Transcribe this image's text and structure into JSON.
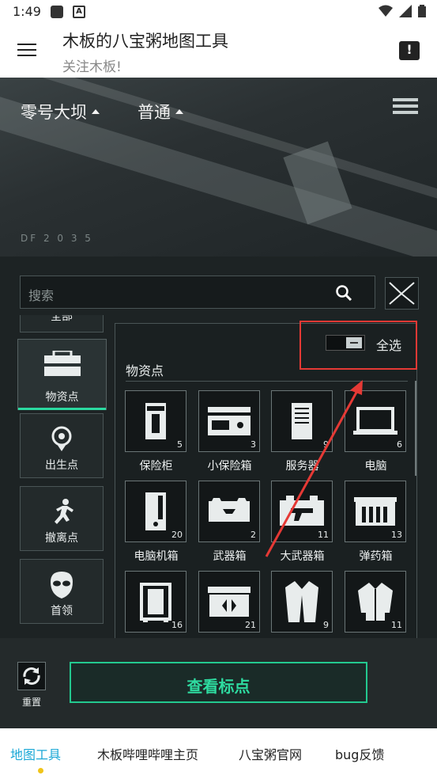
{
  "status_bar": {
    "time": "1:49",
    "icons": [
      "wifi-icon",
      "signal-icon",
      "battery-icon"
    ]
  },
  "app_bar": {
    "title": "木板的八宝粥地图工具",
    "subtitle": "关注木板!"
  },
  "map_header": {
    "map_name": "零号大坝",
    "difficulty": "普通",
    "df_text": "DF 2 0 3 5"
  },
  "search": {
    "placeholder": "搜索"
  },
  "categories": [
    {
      "label": "物资点",
      "active": true,
      "icon": "crate-icon"
    },
    {
      "label": "出生点",
      "active": false,
      "icon": "location-target-icon"
    },
    {
      "label": "撤离点",
      "active": false,
      "icon": "running-man-icon"
    },
    {
      "label": "首领",
      "active": false,
      "icon": "mask-icon"
    }
  ],
  "top_partial_category": "全部",
  "select_all": {
    "label": "全选"
  },
  "section_title": "物资点",
  "items": [
    {
      "label": "保险柜",
      "count": "5",
      "icon": "safe-icon"
    },
    {
      "label": "小保险箱",
      "count": "3",
      "icon": "small-safe-icon"
    },
    {
      "label": "服务器",
      "count": "9",
      "icon": "server-icon"
    },
    {
      "label": "电脑",
      "count": "6",
      "icon": "laptop-icon"
    },
    {
      "label": "电脑机箱",
      "count": "20",
      "icon": "pc-case-icon"
    },
    {
      "label": "武器箱",
      "count": "2",
      "icon": "weapon-case-icon"
    },
    {
      "label": "大武器箱",
      "count": "11",
      "icon": "large-weapon-case-icon"
    },
    {
      "label": "弹药箱",
      "count": "13",
      "icon": "ammo-box-icon"
    },
    {
      "label": "",
      "count": "16",
      "icon": "luggage-icon"
    },
    {
      "label": "",
      "count": "21",
      "icon": "supply-crate-icon"
    },
    {
      "label": "",
      "count": "9",
      "icon": "coat-icon"
    },
    {
      "label": "",
      "count": "11",
      "icon": "jacket-icon"
    }
  ],
  "reset": {
    "label": "重置"
  },
  "view_button": {
    "label": "查看标点"
  },
  "tabs": [
    {
      "label": "地图工具",
      "selected": true
    },
    {
      "label": "木板哔哩哔哩主页",
      "selected": false
    },
    {
      "label": "八宝粥官网",
      "selected": false
    },
    {
      "label": "bug反馈",
      "selected": false
    }
  ],
  "colors": {
    "accent_green": "#2edba0",
    "tab_selected": "#1ba8d6",
    "annotation_red": "#e53935"
  }
}
